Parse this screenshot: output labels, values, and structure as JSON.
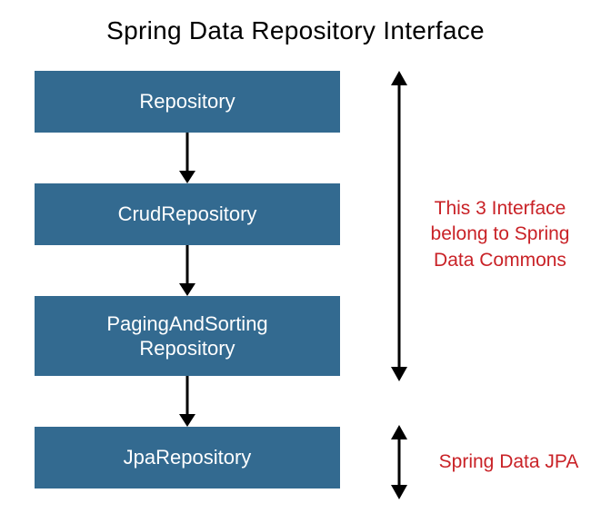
{
  "title": "Spring Data Repository Interface",
  "boxes": {
    "b1": "Repository",
    "b2": "CrudRepository",
    "b3": "PagingAndSorting\nRepository",
    "b4": "JpaRepository"
  },
  "annotations": {
    "a1": "This 3 Interface belong to Spring Data Commons",
    "a2": "Spring Data JPA"
  },
  "colors": {
    "box_bg": "#336a90",
    "box_text": "#ffffff",
    "annotation": "#c92227"
  }
}
